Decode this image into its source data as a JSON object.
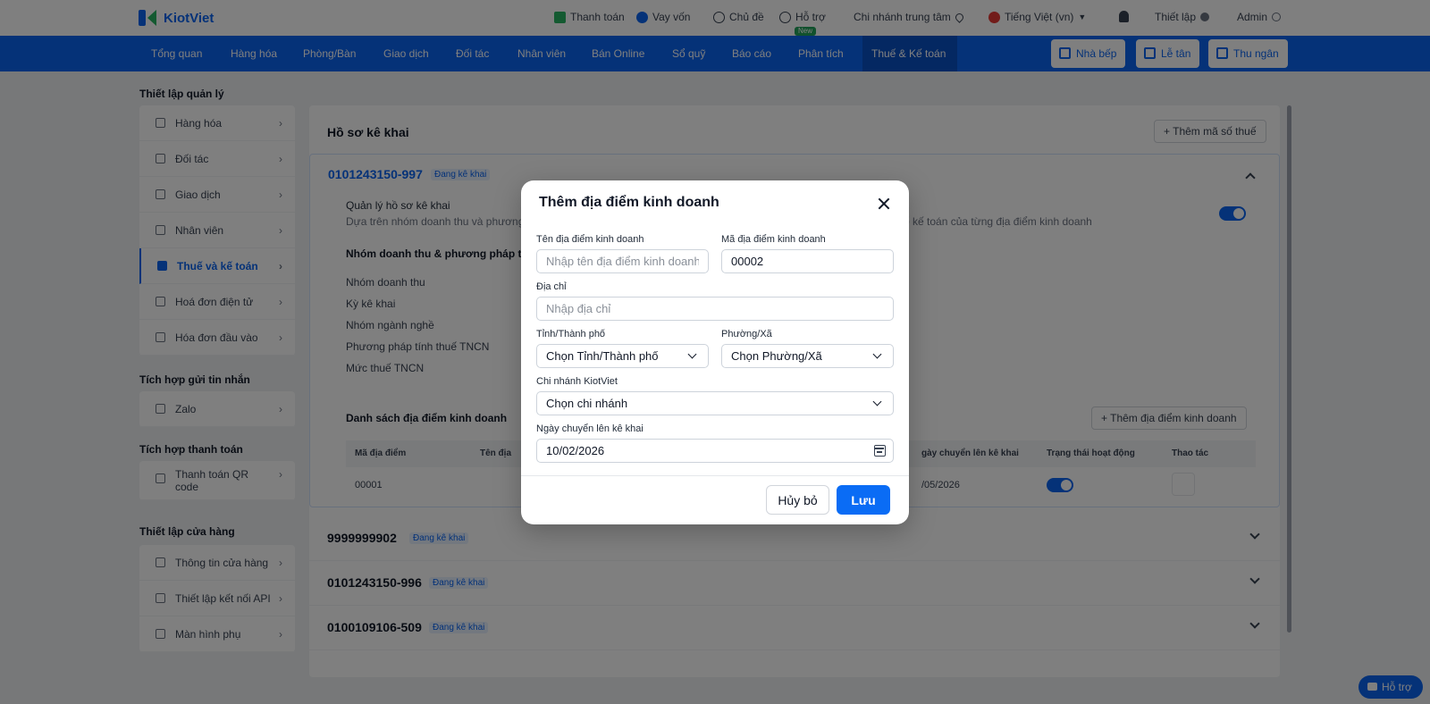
{
  "topbar": {
    "logo_text": "KiotViet",
    "items": [
      "Thanh toán",
      "Vay vốn",
      "Chủ đề",
      "Hỗ trợ",
      "Chi nhánh trung tâm",
      "Tiếng Việt (vn)",
      "Thiết lập",
      "Admin"
    ],
    "new_badge": "New"
  },
  "nav": {
    "items": [
      "Tổng quan",
      "Hàng hóa",
      "Phòng/Bàn",
      "Giao dịch",
      "Đối tác",
      "Nhân viên",
      "Bán Online",
      "Sổ quỹ",
      "Báo cáo",
      "Phân tích",
      "Thuế & Kế toán"
    ],
    "active": "Thuế & Kế toán",
    "buttons": [
      "Nhà bếp",
      "Lễ tân",
      "Thu ngân"
    ]
  },
  "sidebar": {
    "groups": [
      {
        "title": "Thiết lập quản lý",
        "items": [
          "Hàng hóa",
          "Đối tác",
          "Giao dịch",
          "Nhân viên",
          "Thuế và kế toán",
          "Hoá đơn điện tử",
          "Hóa đơn đầu vào"
        ]
      },
      {
        "title": "Tích hợp gửi tin nhắn",
        "items": [
          "Zalo"
        ]
      },
      {
        "title": "Tích hợp thanh toán",
        "items": [
          "Thanh toán QR code"
        ]
      },
      {
        "title": "Thiết lập cửa hàng",
        "items": [
          "Thông tin cửa hàng",
          "Thiết lập kết nối API",
          "Màn hình phụ"
        ]
      }
    ]
  },
  "main": {
    "title": "Hồ sơ kê khai",
    "add_tax_button": "Thêm mã số thuế",
    "open_section": {
      "tax_code": "0101243150-997",
      "status": "Đang kê khai",
      "manage_label": "Quản lý hồ sơ kê khai",
      "manage_desc_left": "Dựa trên nhóm doanh thu và phương",
      "manage_desc_right": "ổ kế toán của từng địa điểm kinh doanh",
      "group_heading": "Nhóm doanh thu & phương pháp tín",
      "rows": [
        "Nhóm doanh thu",
        "Kỳ kê khai",
        "Nhóm ngành nghề",
        "Phương pháp tính thuế TNCN",
        "Mức thuế TNCN"
      ],
      "list_heading": "Danh sách địa điểm kinh doanh",
      "add_location_button": "Thêm địa điểm kinh doanh",
      "table_headers": [
        "Mã địa điểm",
        "Tên địa",
        "gày chuyển lên kê khai",
        "Trạng thái hoạt động",
        "Thao tác"
      ],
      "table_row": {
        "code": "00001",
        "date": "/05/2026"
      }
    },
    "collapsed": [
      {
        "code": "9999999902",
        "status": "Đang kê khai"
      },
      {
        "code": "0101243150-996",
        "status": "Đang kê khai"
      },
      {
        "code": "0100109106-509",
        "status": "Đang kê khai"
      }
    ]
  },
  "help_button": "Hỗ trợ",
  "modal": {
    "title": "Thêm địa điểm kinh doanh",
    "fields": {
      "name_label": "Tên địa điểm kinh doanh",
      "name_placeholder": "Nhập tên địa điểm kinh doanh",
      "code_label": "Mã địa điểm kinh doanh",
      "code_value": "00002",
      "address_label": "Địa chỉ",
      "address_placeholder": "Nhập địa chỉ",
      "province_label": "Tỉnh/Thành phố",
      "province_value": "Chọn Tỉnh/Thành phố",
      "ward_label": "Phường/Xã",
      "ward_value": "Chọn Phường/Xã",
      "branch_label": "Chi nhánh KiotViet",
      "branch_value": "Chọn chi nhánh",
      "date_label": "Ngày chuyển lên kê khai",
      "date_value": "10/02/2026"
    },
    "cancel_label": "Hủy bỏ",
    "save_label": "Lưu"
  },
  "colors": {
    "primary": "#0a64f0",
    "save_button": "#0a6cf5",
    "success": "#22a35a"
  }
}
